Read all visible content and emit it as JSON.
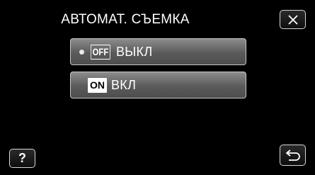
{
  "header": {
    "title": "АВТОМАТ. СЪЕМКА"
  },
  "options": [
    {
      "badge": "OFF",
      "label": "ВЫКЛ"
    },
    {
      "badge": "ON",
      "label": "ВКЛ"
    }
  ],
  "buttons": {
    "help_label": "?"
  },
  "icons": {
    "close": "close-icon",
    "back": "back-arrow-icon",
    "selected": "selected-dot-icon"
  }
}
